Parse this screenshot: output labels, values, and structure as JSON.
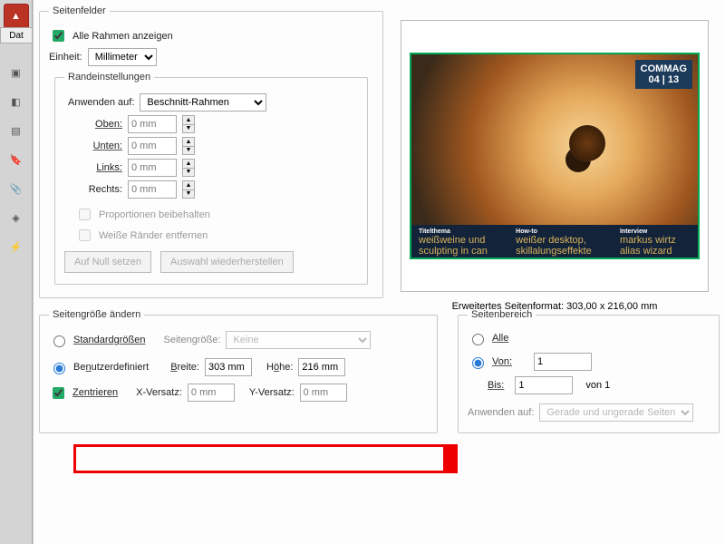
{
  "toolbar_tab": "Dat",
  "page_boxes": {
    "legend": "Seitenfelder",
    "show_all_boxes": "Alle Rahmen anzeigen",
    "unit_label": "Einheit:",
    "unit_value": "Millimeter",
    "margin_legend": "Randeinstellungen",
    "apply_to_label": "Anwenden auf:",
    "apply_to_value": "Beschnitt-Rahmen",
    "top_label": "Oben:",
    "bottom_label": "Unten:",
    "left_label": "Links:",
    "right_label": "Rechts:",
    "zero_mm": "0 mm",
    "constrain": "Proportionen beibehalten",
    "remove_white": "Weiße Ränder entfernen",
    "reset_btn": "Auf Null setzen",
    "restore_btn": "Auswahl wiederherstellen"
  },
  "preview": {
    "badge_line1": "COMMAG",
    "badge_line2": "04 | 13",
    "foot1_title": "Titelthema",
    "foot1_sub": "weißweine und sculpting in can",
    "foot2_title": "How-to",
    "foot2_sub": "weißer desktop, skillalungseffekte",
    "foot3_title": "Interview",
    "foot3_sub": "markus wirtz alias wizard",
    "extended_label": "Erweitertes Seitenformat: 303,00 x 216,00 mm"
  },
  "change_size": {
    "legend": "Seitengröße ändern",
    "std_label": "Standardgrößen",
    "pagesize_label": "Seitengröße:",
    "pagesize_value": "Keine",
    "custom_label": "Benutzerdefiniert",
    "width_label": "Breite:",
    "width_value": "303 mm",
    "height_label": "Höhe:",
    "height_value": "216 mm",
    "center_label": "Zentrieren",
    "xoff_label": "X-Versatz:",
    "xoff_value": "0 mm",
    "yoff_label": "Y-Versatz:",
    "yoff_value": "0 mm"
  },
  "page_range": {
    "legend": "Seitenbereich",
    "all_label": "Alle",
    "from_label": "Von:",
    "from_value": "1",
    "to_label": "Bis:",
    "to_value": "1",
    "of_suffix": "von 1",
    "apply_label": "Anwenden auf:",
    "apply_value": "Gerade und ungerade Seiten"
  }
}
